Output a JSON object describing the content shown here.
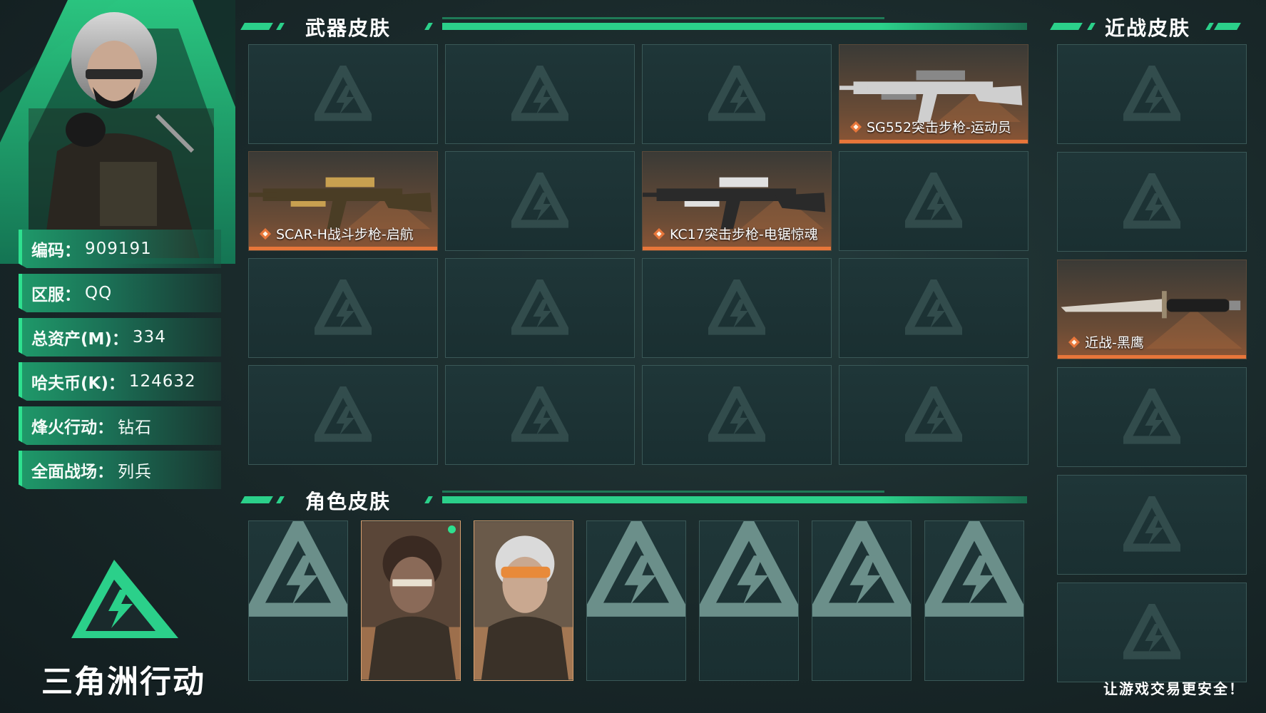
{
  "profile": {
    "rows": [
      {
        "label": "编码：",
        "value": "909191"
      },
      {
        "label": "区服：",
        "value": "QQ"
      },
      {
        "label": "总资产(M)：",
        "value": "334"
      },
      {
        "label": "哈夫币(K)：",
        "value": "124632"
      },
      {
        "label": "烽火行动：",
        "value": "钻石"
      },
      {
        "label": "全面战场：",
        "value": "列兵"
      }
    ]
  },
  "brand": {
    "name": "三角洲行动"
  },
  "sections": {
    "weapon_title": "武器皮肤",
    "melee_title": "近战皮肤",
    "character_title": "角色皮肤"
  },
  "weapon_skins": [
    {
      "label": ""
    },
    {
      "label": ""
    },
    {
      "label": ""
    },
    {
      "label": "SG552突击步枪-运动员"
    },
    {
      "label": "SCAR-H战斗步枪-启航"
    },
    {
      "label": ""
    },
    {
      "label": "KC17突击步枪-电锯惊魂"
    },
    {
      "label": ""
    },
    {
      "label": ""
    },
    {
      "label": ""
    },
    {
      "label": ""
    },
    {
      "label": ""
    },
    {
      "label": ""
    },
    {
      "label": ""
    },
    {
      "label": ""
    },
    {
      "label": ""
    }
  ],
  "melee_skins": [
    {
      "label": ""
    },
    {
      "label": ""
    },
    {
      "label": "近战-黑鹰"
    },
    {
      "label": ""
    },
    {
      "label": ""
    },
    {
      "label": ""
    }
  ],
  "character_skins": [
    {
      "filled": false
    },
    {
      "filled": true,
      "new": true
    },
    {
      "filled": true
    },
    {
      "filled": false
    },
    {
      "filled": false
    },
    {
      "filled": false
    },
    {
      "filled": false
    }
  ],
  "footer": {
    "slogan": "让游戏交易更安全！"
  },
  "colors": {
    "accent": "#2bd08a",
    "rarity": "#e8763a",
    "background": "#1a2a2c"
  },
  "icons": [
    "delta-watermark-icon",
    "rarity-diamond-icon",
    "delta-logo-icon"
  ]
}
